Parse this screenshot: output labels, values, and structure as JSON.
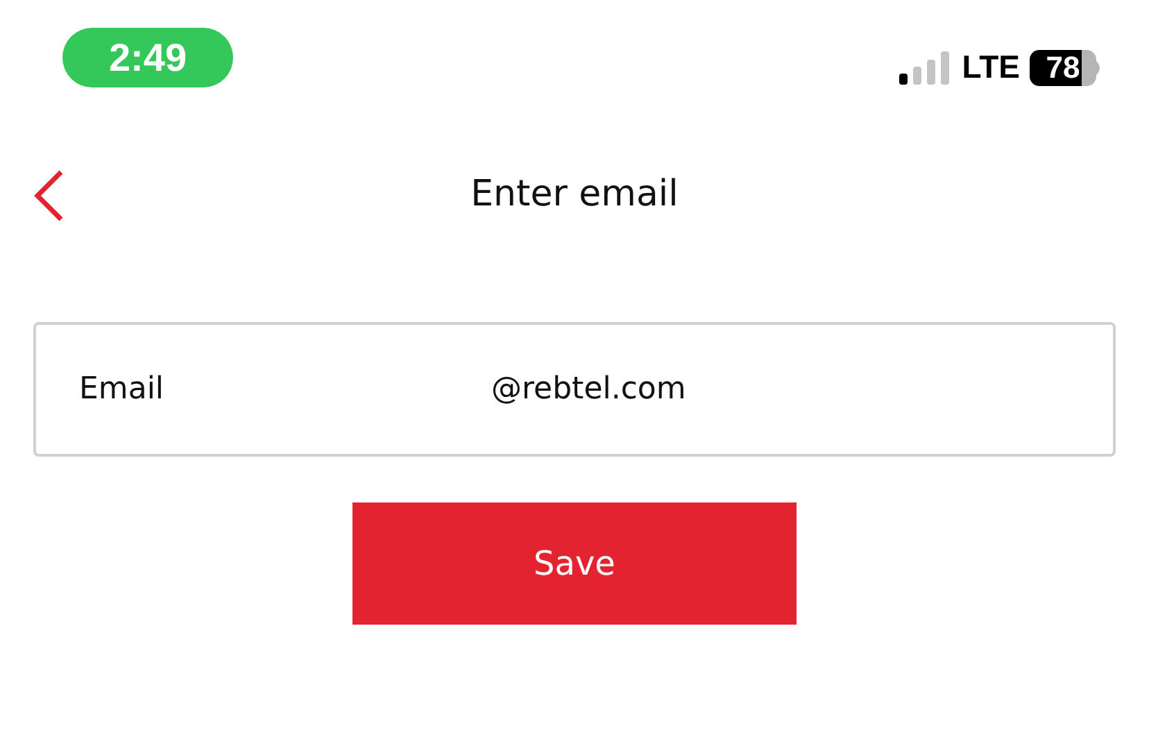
{
  "status_bar": {
    "time": "2:49",
    "network": "LTE",
    "battery": "78"
  },
  "nav": {
    "title": "Enter email"
  },
  "email_field": {
    "label": "Email",
    "value": "@rebtel.com"
  },
  "save_button": {
    "label": "Save"
  }
}
